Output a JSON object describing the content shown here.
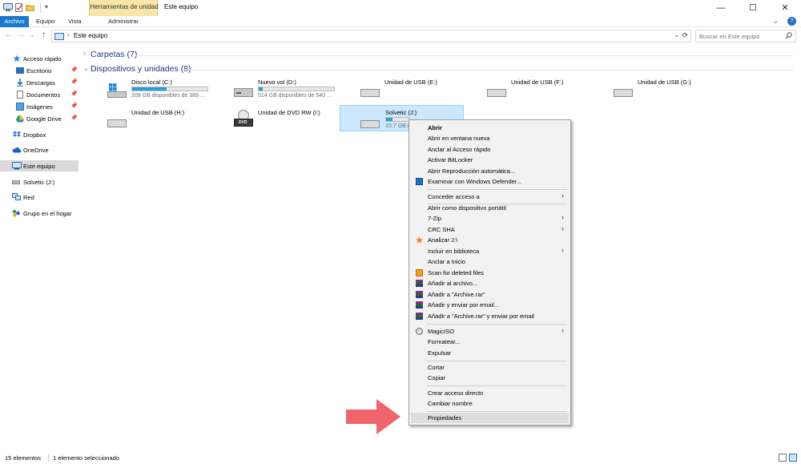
{
  "window": {
    "title": "Este equipo",
    "contextual_tab_group": "Herramientas de unidad",
    "minimize": "—",
    "maximize": "☐",
    "close": "✕"
  },
  "ribbon": {
    "tabs": [
      "Archivo",
      "Equipo",
      "Vista",
      "Administrar"
    ],
    "expand": "⌄",
    "help": "?"
  },
  "address": {
    "back": "←",
    "forward": "→",
    "recent": "⌄",
    "up": "↑",
    "chevron": "›",
    "path": "Este equipo",
    "dropdown": "⌄",
    "refresh": "⟳",
    "search_placeholder": "Buscar en Este equipo"
  },
  "sidebar": {
    "quick_access": "Acceso rápido",
    "pin": "📌",
    "pinned": [
      "Escritorio",
      "Descargas",
      "Documentos",
      "Imágenes",
      "Google Drive"
    ],
    "dropbox": "Dropbox",
    "onedrive": "OneDrive",
    "this_pc": "Este equipo",
    "solvetic": "Solvetic (J:)",
    "network": "Red",
    "homegroup": "Grupo en el hogar"
  },
  "content": {
    "folders_header": "Carpetas (7)",
    "devices_header": "Dispositivos y unidades (8)",
    "chev_collapsed": "›",
    "chev_expanded": "⌄",
    "drives": [
      {
        "name": "Disco local (C:)",
        "free": "209 GB disponibles de 389 ...",
        "used_fraction": 0.46
      },
      {
        "name": "Nuevo vol (D:)",
        "free": "514 GB disponibles de 540 ...",
        "used_fraction": 0.05
      },
      {
        "name": "Unidad de USB (E:)"
      },
      {
        "name": "Unidad de USB (F:)"
      },
      {
        "name": "Unidad de USB (G:)"
      },
      {
        "name": "Unidad de USB (H:)"
      },
      {
        "name": "Unidad de DVD RW (I:)",
        "dvd_label": "DVD"
      },
      {
        "name": "Solvetic (J:)",
        "free": "10,7 GB di",
        "used_fraction": 0.3
      }
    ]
  },
  "context_menu": {
    "submenu_arrow": "›",
    "items": [
      "Abrir",
      "Abrir en ventana nueva",
      "Anclar al Acceso rápido",
      "Activar BitLocker",
      "Abrir Reproducción automática...",
      "Examinar con Windows Defender...",
      "Conceder acceso a",
      "Abrir como dispositivo portátil",
      "7-Zip",
      "CRC SHA",
      "Analizar J:\\",
      "Incluir en biblioteca",
      "Anclar a Inicio",
      "Scan for deleted files",
      "Añadir al archivo...",
      "Añadir a \"Archive.rar\"",
      "Añadir y enviar por email...",
      "Añadir a \"Archive.rar\" y enviar por email",
      "MagicISO",
      "Formatear...",
      "Expulsar",
      "Cortar",
      "Copiar",
      "Crear acceso directo",
      "Cambiar nombre",
      "Propiedades"
    ]
  },
  "status": {
    "item_count": "15 elementos",
    "selection": "1 elemento seleccionado"
  },
  "colors": {
    "accent": "#1979ca",
    "selection": "#cce8ff",
    "drive_bar": "#26a0da",
    "arrow": "#f0646c"
  }
}
